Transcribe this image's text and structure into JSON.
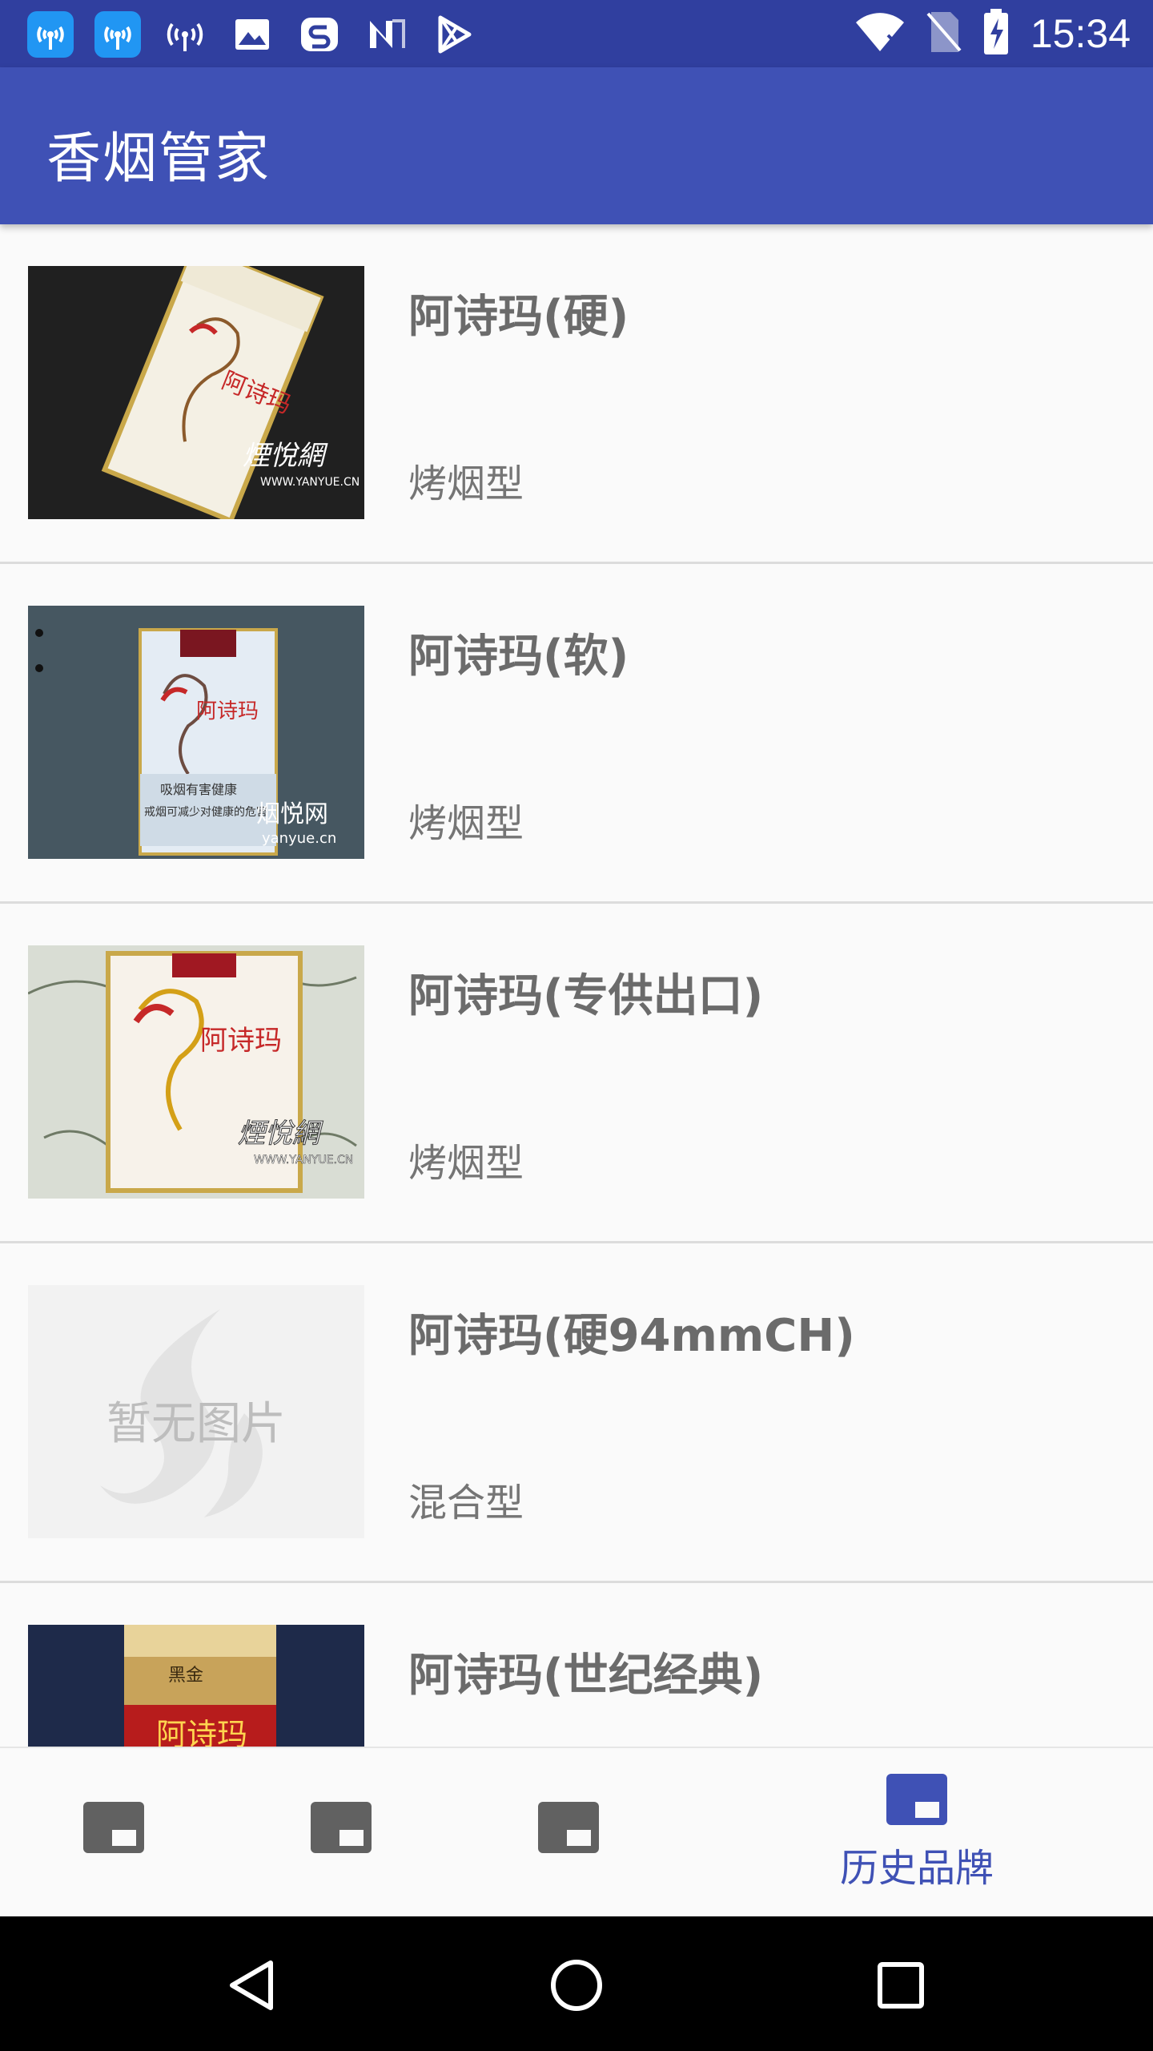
{
  "status_bar": {
    "time": "15:34",
    "left_icons": [
      "hotspot-badge-icon",
      "hotspot-badge-icon",
      "hotspot-icon",
      "image-icon",
      "s-app-icon",
      "n-app-icon",
      "play-store-icon"
    ],
    "right_icons": [
      "wifi-icon",
      "no-sim-icon",
      "battery-charging-icon"
    ]
  },
  "app_bar": {
    "title": "香烟管家"
  },
  "list": {
    "items": [
      {
        "name": "阿诗玛(硬)",
        "type": "烤烟型",
        "thumb": "pack-white-hard",
        "watermark": "煙悅網"
      },
      {
        "name": "阿诗玛(软)",
        "type": "烤烟型",
        "thumb": "pack-blue-soft",
        "watermark": "烟悦网"
      },
      {
        "name": "阿诗玛(专供出口)",
        "type": "烤烟型",
        "thumb": "pack-white-export",
        "watermark": "煙悅網"
      },
      {
        "name": "阿诗玛(硬94mmCH)",
        "type": "混合型",
        "thumb": "placeholder",
        "placeholder_text": "暂无图片"
      },
      {
        "name": "阿诗玛(世纪经典)",
        "type": "",
        "thumb": "pack-red-classic",
        "logo_text": "阿诗玛"
      }
    ]
  },
  "bottom_nav": {
    "tabs": [
      {
        "label": "",
        "icon": "featured-video-icon",
        "active": false
      },
      {
        "label": "",
        "icon": "featured-video-icon",
        "active": false
      },
      {
        "label": "",
        "icon": "featured-video-icon",
        "active": false
      },
      {
        "label": "历史品牌",
        "icon": "featured-video-icon",
        "active": true
      }
    ]
  },
  "system_nav": {
    "buttons": [
      "back-icon",
      "home-icon",
      "recents-icon"
    ]
  },
  "colors": {
    "primary": "#3f51b5",
    "primary_dark": "#303f9f",
    "text_secondary": "#757575"
  }
}
